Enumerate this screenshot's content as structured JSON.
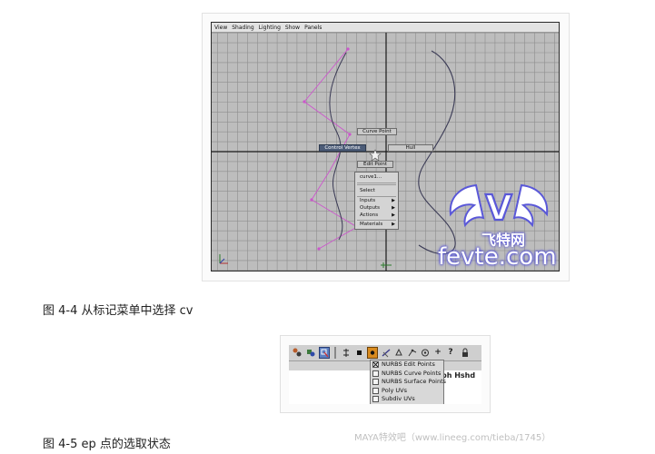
{
  "figure1": {
    "viewport_menu": [
      "View",
      "Shading",
      "Lighting",
      "Show",
      "Panels"
    ],
    "marking_menu": {
      "curve_point": "Curve Point",
      "control_vertex": "Control Vertex",
      "hull": "Hull",
      "edit_point": "Edit Point"
    },
    "context_menu": {
      "object_name": "curve1...",
      "items": [
        {
          "label": "Select",
          "submenu": false
        },
        {
          "label": "Inputs",
          "submenu": true
        },
        {
          "label": "Outputs",
          "submenu": true
        },
        {
          "label": "Actions",
          "submenu": true
        },
        {
          "label": "Materials",
          "submenu": true
        }
      ]
    },
    "caption": "图 4-4 从标记菜单中选择 cv"
  },
  "figure2": {
    "toolbar_right_text": "ph Hshd",
    "dropdown_options": [
      {
        "label": "NURBS Edit Points",
        "checked": true
      },
      {
        "label": "NURBS Curve Points",
        "checked": false
      },
      {
        "label": "NURBS Surface Points",
        "checked": false
      },
      {
        "label": "Poly UVs",
        "checked": false
      },
      {
        "label": "Subdiv UVs",
        "checked": false
      }
    ],
    "caption": "图 4-5 ep 点的选取状态"
  },
  "watermark": {
    "logo_letter": "V",
    "chinese": "飞特网",
    "site": "fevte.com",
    "footer": "MAYA特效吧（www.lineeg.com/tieba/1745）"
  },
  "colors": {
    "viewport_bg": "#bdbdbd",
    "grid_line": "#8e8e8e",
    "axis_line": "#1a1a1a",
    "cv_hull": "#cc55cc",
    "curve": "#3a3a55",
    "selected_item": "#4c5c78",
    "watermark": "#5a58d8"
  }
}
